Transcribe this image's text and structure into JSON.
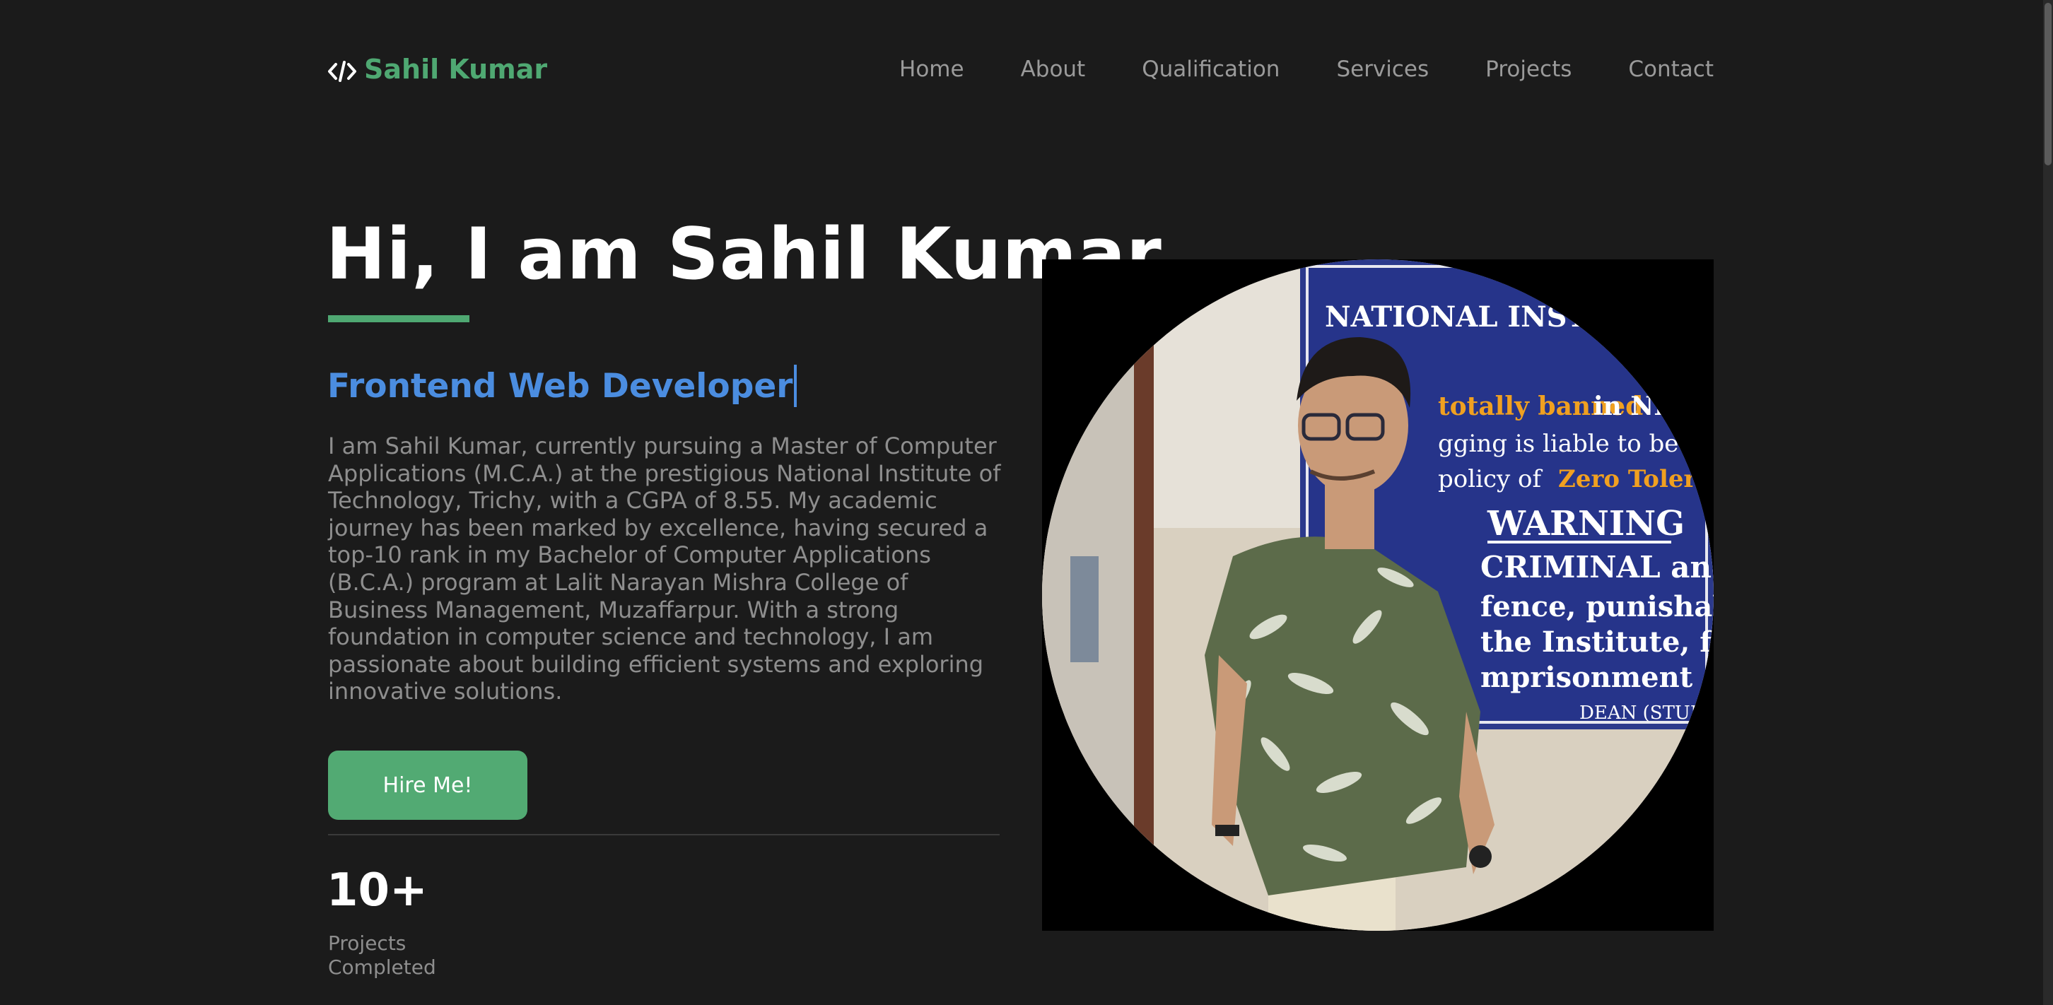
{
  "header": {
    "brand_name": "Sahil Kumar",
    "brand_icon": "code-icon",
    "nav": [
      "Home",
      "About",
      "Qualification",
      "Services",
      "Projects",
      "Contact"
    ]
  },
  "hero": {
    "title": "Hi, I am Sahil Kumar",
    "role": "Frontend Web Developer",
    "bio": "I am Sahil Kumar, currently pursuing a Master of Computer Applications (M.C.A.) at the prestigious National Institute of Technology, Trichy, with a CGPA of 8.55. My academic journey has been marked by excellence, having secured a top-10 rank in my Bachelor of Computer Applications (B.C.A.) program at Lalit Narayan Mishra College of Business Management, Muzaffarpur. With a strong foundation in computer science and technology, I am passionate about building efficient systems and exploring innovative solutions.",
    "cta_label": "Hire Me!",
    "stat": {
      "value": "10+",
      "label": "Projects Completed"
    },
    "photo_sign": {
      "heading": "NATIONAL INSTITUTE OF T",
      "line1_a": "totally banned",
      "line1_b": " in NIT",
      "line2": "gging is liable to be puni",
      "line3_a": "policy of ",
      "line3_b": "Zero Tolerance to",
      "warning": "WARNING",
      "line5": "CRIMINAL and",
      "line6": "fence, punishab",
      "line7": "the Institute, f",
      "line8": "mprisonment",
      "signoff": "DEAN (STUDE"
    }
  },
  "colors": {
    "background": "#1b1b1b",
    "accent_green": "#4fa872",
    "accent_blue": "#4b8de0",
    "text_muted": "#8e8e8e"
  }
}
